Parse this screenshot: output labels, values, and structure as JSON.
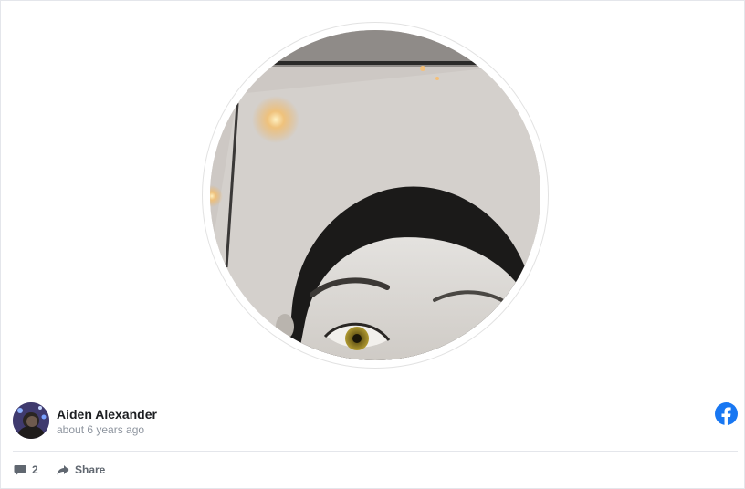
{
  "post": {
    "author": "Aiden Alexander",
    "time": "about 6 years ago",
    "photo_icon": "profile-photo-icon",
    "avatar_icon": "user-avatar-icon",
    "platform_icon": "facebook-icon"
  },
  "actions": {
    "comments_icon": "comment-icon",
    "comments_count": "2",
    "share_icon": "share-arrow-icon",
    "share_label": "Share"
  },
  "colors": {
    "facebook_blue": "#1877f2",
    "name_text": "#1c1e21",
    "muted_text": "#8d949e",
    "action_text": "#606770"
  }
}
